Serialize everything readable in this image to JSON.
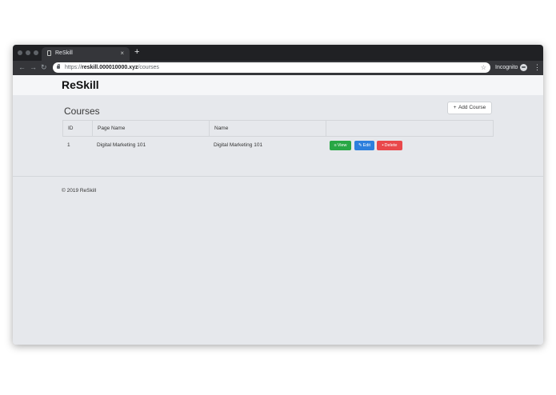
{
  "browser": {
    "tab_title": "ReSkill",
    "tab_close": "×",
    "new_tab": "+",
    "url_scheme": "https://",
    "url_host": "reskill.000010000.xyz",
    "url_path": "/courses",
    "incognito_label": "Incognito"
  },
  "navbar": {
    "brand": "ReSkill"
  },
  "main": {
    "heading": "Courses",
    "add_button_label": "Add Course",
    "table": {
      "columns": [
        "ID",
        "Page Name",
        "Name",
        ""
      ],
      "rows": [
        {
          "id": "1",
          "page_name": "Digital Marketing 101",
          "name": "Digital Marketing 101"
        }
      ],
      "actions": {
        "view": "View",
        "edit": "Edit",
        "delete": "Delete"
      }
    }
  },
  "footer": {
    "text": "© 2019 ReSkill"
  },
  "colors": {
    "view": "#28a745",
    "edit": "#2d7fdd",
    "delete": "#e9484b"
  },
  "icons": [
    "page-icon",
    "lock-icon",
    "star-icon",
    "incognito-icon",
    "kebab-menu-icon",
    "plus-icon",
    "list-icon",
    "pencil-icon",
    "trash-icon"
  ]
}
